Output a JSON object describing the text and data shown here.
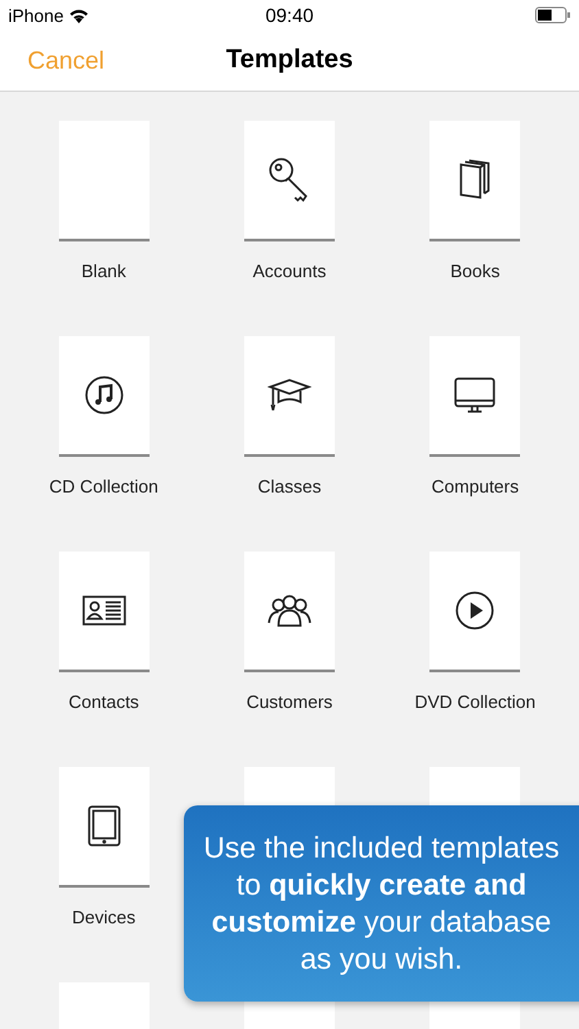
{
  "status_bar": {
    "carrier": "iPhone",
    "time": "09:40"
  },
  "nav": {
    "cancel": "Cancel",
    "title": "Templates"
  },
  "templates": [
    {
      "kind": "labeled",
      "label": "Blank"
    },
    {
      "kind": "labeled",
      "label": "Accounts"
    },
    {
      "kind": "labeled",
      "label": "Books"
    },
    {
      "kind": "labeled",
      "label": "CD Collection"
    },
    {
      "kind": "labeled",
      "label": "Classes"
    },
    {
      "kind": "labeled",
      "label": "Computers"
    },
    {
      "kind": "labeled",
      "label": "Contacts"
    },
    {
      "kind": "labeled",
      "label": "Customers"
    },
    {
      "kind": "labeled",
      "label": "DVD Collection"
    },
    {
      "kind": "labeled",
      "label": "Devices"
    },
    {
      "kind": "covered"
    },
    {
      "kind": "covered"
    },
    {
      "kind": "covered"
    },
    {
      "kind": "covered"
    },
    {
      "kind": "covered"
    }
  ],
  "banner": {
    "text": "Use the included templates to **quickly create and customize** your database as you wish."
  }
}
